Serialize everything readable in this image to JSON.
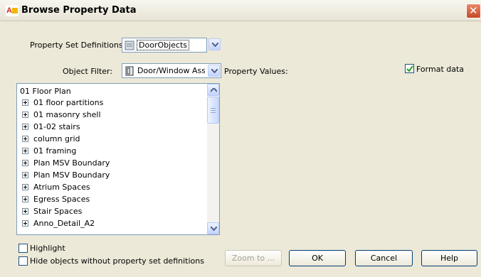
{
  "window": {
    "title": "Browse Property Data"
  },
  "property_set": {
    "label": "Property Set Definitions:",
    "value": "DoorObjects"
  },
  "object_filter": {
    "label": "Object Filter:",
    "value": "Door/Window Ass"
  },
  "property_values_label": "Property Values:",
  "format_data": {
    "label": "Format data",
    "checked": true
  },
  "tree": {
    "root": "01 Floor Plan",
    "items": [
      "01 floor partitions",
      "01 masonry shell",
      "01-02 stairs",
      "column grid",
      "01 framing",
      "Plan MSV Boundary",
      "Plan MSV Boundary",
      "Atrium Spaces",
      "Egress Spaces",
      "Stair Spaces",
      "Anno_Detail_A2"
    ]
  },
  "highlight": {
    "label": "Highlight",
    "checked": false
  },
  "hide_objects": {
    "label": "Hide objects without property set definitions",
    "checked": false
  },
  "buttons": {
    "zoom": "Zoom to ...",
    "ok": "OK",
    "cancel": "Cancel",
    "help": "Help"
  },
  "icons": {
    "app": "autocad-app-icon",
    "close": "close-icon",
    "property_set": "property-set-icon",
    "object_filter": "door-window-icon"
  },
  "colors": {
    "close": "#c64a25",
    "check": "#21a121",
    "accent": "#003c74"
  }
}
